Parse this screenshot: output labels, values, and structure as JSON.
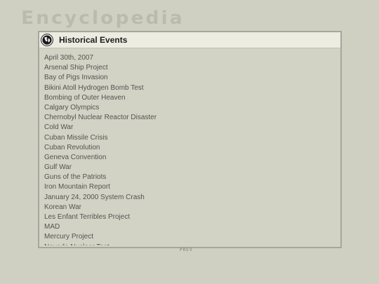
{
  "app": {
    "title": "Encyclopedia"
  },
  "panel": {
    "title": "Historical Events",
    "icon": "globe-icon",
    "items": [
      "April 30th, 2007",
      "Arsenal Ship Project",
      "Bay of Pigs Invasion",
      "Bikini Atoll Hydrogen Bomb Test",
      "Bombing of Outer Heaven",
      "Calgary Olympics",
      "Chernobyl Nuclear Reactor Disaster",
      "Cold War",
      "Cuban Missile Crisis",
      "Cuban Revolution",
      "Geneva Convention",
      "Gulf War",
      "Guns of the Patriots",
      "Iron Mountain Report",
      "January 24, 2000 System Crash",
      "Korean War",
      "Les Enfant Terribles Project",
      "MAD",
      "Mercury Project",
      "Nevada Nuclear Test"
    ]
  },
  "pagination": {
    "prev_label": "PREV"
  },
  "colors": {
    "background": "#d0d0c2",
    "header": "#ecece0",
    "text": "#545450",
    "border": "#a6a69c"
  }
}
